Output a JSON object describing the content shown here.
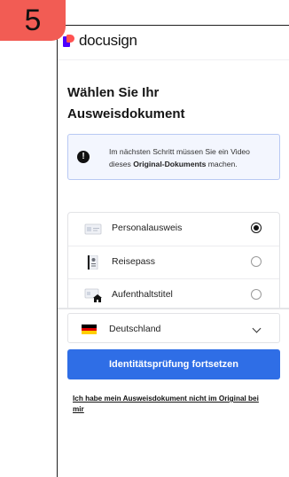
{
  "step_badge": "5",
  "header": {
    "logo_text": "docusign"
  },
  "title": "Wählen Sie Ihr Ausweisdokument",
  "info": {
    "icon": "info-exclamation-icon",
    "text_before": "Im nächsten Schritt müssen Sie ein Video dieses ",
    "text_bold": "Original-Dokuments",
    "text_after": " machen."
  },
  "document_options": [
    {
      "label": "Personalausweis",
      "icon": "id-card-icon",
      "selected": true
    },
    {
      "label": "Reisepass",
      "icon": "passport-icon",
      "selected": false
    },
    {
      "label": "Aufenthaltstitel",
      "icon": "residence-permit-icon",
      "selected": false
    }
  ],
  "country": {
    "label": "Deutschland",
    "icon": "germany-flag-icon"
  },
  "cta_label": "Identitätsprüfung fortsetzen",
  "missing_doc_link": "Ich habe mein Ausweisdokument nicht im Original bei mir",
  "colors": {
    "accent": "#2f6ee6",
    "badge": "#f25c54",
    "logo_purple": "#4c00ff",
    "logo_coral": "#ff5252"
  }
}
